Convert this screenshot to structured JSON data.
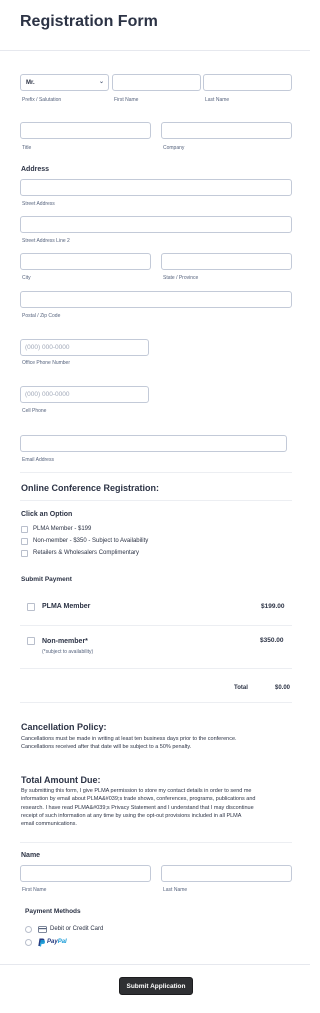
{
  "form": {
    "title": "Registration Form",
    "submit_label": "Submit Application"
  },
  "name_row": {
    "prefix_value": "Mr.",
    "prefix_label": "Prefix / Salutation",
    "first_label": "First Name",
    "last_label": "Last Name"
  },
  "title_row": {
    "title_label": "Title",
    "company_label": "Company"
  },
  "address": {
    "heading": "Address",
    "street_label": "Street Address",
    "street2_label": "Street Address Line 2",
    "city_label": "City",
    "state_label": "State / Province",
    "postal_label": "Postal / Zip Code"
  },
  "phones": {
    "office_placeholder": "(000) 000-0000",
    "office_label": "Office Phone Number",
    "cell_placeholder": "(000) 000-0000",
    "cell_label": "Cell Phone",
    "email_label": "Email Address"
  },
  "conference": {
    "heading": "Online Conference Registration:",
    "option_heading": "Click an Option",
    "options": [
      "PLMA Member - $199",
      "Non-member - $350 - Subject to Availability",
      "Retailers & Wholesalers Complimentary"
    ]
  },
  "payment": {
    "heading": "Submit Payment",
    "products": [
      {
        "name": "PLMA Member",
        "price": "$199.00",
        "note": ""
      },
      {
        "name": "Non-member*",
        "price": "$350.00",
        "note": "(*subject to availability)"
      }
    ],
    "total_label": "Total",
    "total_value": "$0.00"
  },
  "cancellation": {
    "heading": "Cancellation Policy:",
    "lines": [
      "Cancellations must be made in writing at least ten business days prior to the conference.",
      "Cancellations received after that date will be subject to a 50% penalty."
    ]
  },
  "total_due": {
    "heading": "Total Amount Due:",
    "lines": [
      "By submitting this form, I give PLMA permission to store my contact details in order to send me",
      "information by email about PLMA&#039;s trade shows, conferences, programs, publications and",
      "research. I have read PLMA&#039;s Privacy Statement and I understand that I may discontinue",
      "receipt of such information at any time by using the opt-out provisions included in all PLMA",
      "email communications."
    ]
  },
  "signer": {
    "heading": "Name",
    "first_label": "First Name",
    "last_label": "Last Name"
  },
  "payment_methods": {
    "heading": "Payment Methods",
    "card_label": "Debit or Credit Card",
    "paypal_label": "PayPal",
    "card_icon": "credit-card-icon",
    "paypal_icon": "paypal-logo"
  },
  "colors": {
    "paypal_dark": "#253b80",
    "paypal_light": "#179bd7",
    "button": "#2f3033"
  }
}
